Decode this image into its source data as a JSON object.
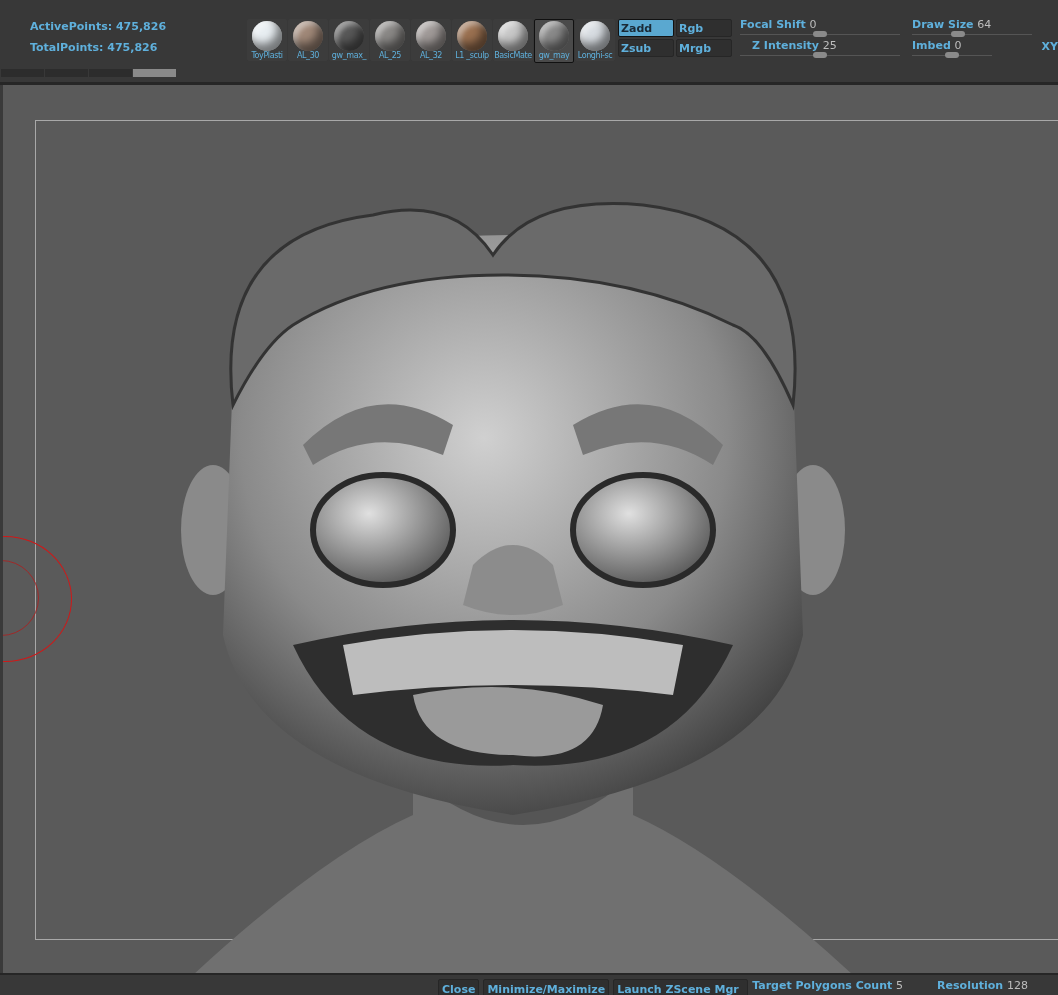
{
  "stats": [
    {
      "label": "ActivePoints:",
      "value": "475,826"
    },
    {
      "label": "TotalPoints:",
      "value": "475,826"
    }
  ],
  "history_segments": [
    {
      "selected": false
    },
    {
      "selected": false
    },
    {
      "selected": false
    },
    {
      "selected": true
    }
  ],
  "materials": [
    {
      "label": "ToyPlasti",
      "color": "#e8eef2",
      "selected": false
    },
    {
      "label": "AL_30",
      "color": "#a08878",
      "selected": false
    },
    {
      "label": "gw_max_",
      "color": "#585858",
      "selected": false
    },
    {
      "label": "AL_25",
      "color": "#8a8886",
      "selected": false
    },
    {
      "label": "AL_32",
      "color": "#a09a98",
      "selected": false
    },
    {
      "label": "L1 _sculp",
      "color": "#9a7050",
      "selected": false
    },
    {
      "label": "BasicMate",
      "color": "#c8c8c8",
      "selected": false
    },
    {
      "label": "gw_may",
      "color": "#8a8a8a",
      "selected": true
    },
    {
      "label": "Longhi-sc",
      "color": "#d8dde2",
      "selected": false
    }
  ],
  "mode_buttons": [
    {
      "label": "Zadd",
      "selected": true
    },
    {
      "label": "Rgb",
      "selected": false
    },
    {
      "label": "Zsub",
      "selected": false
    },
    {
      "label": "Mrgb",
      "selected": false
    }
  ],
  "sliders_left": [
    {
      "label": "Focal Shift",
      "value": "0",
      "level": 0.5
    },
    {
      "label": "Z Intensity",
      "value": "25",
      "level": 0.5
    }
  ],
  "sliders_right": [
    {
      "label": "Draw Size",
      "value": "64",
      "level": 0.38
    },
    {
      "label": "Imbed",
      "value": "0",
      "level": 0.5
    }
  ],
  "edge_label": "XY",
  "bottom_bar": {
    "buttons": [
      "Close",
      "Minimize/Maximize",
      "Launch ZScene Mgr"
    ],
    "fields": [
      {
        "label": "Target Polygons Count",
        "value": "5"
      },
      {
        "label": "Resolution",
        "value": "128"
      }
    ]
  }
}
